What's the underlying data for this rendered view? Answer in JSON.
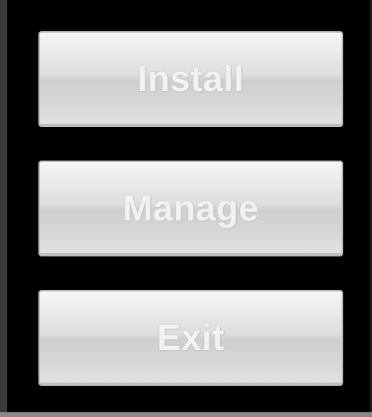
{
  "menu": {
    "buttons": [
      {
        "label": "Install"
      },
      {
        "label": "Manage"
      },
      {
        "label": "Exit"
      }
    ]
  },
  "colors": {
    "background": "#000000",
    "button_face": "#dedede",
    "button_text": "#f2f2f2"
  }
}
